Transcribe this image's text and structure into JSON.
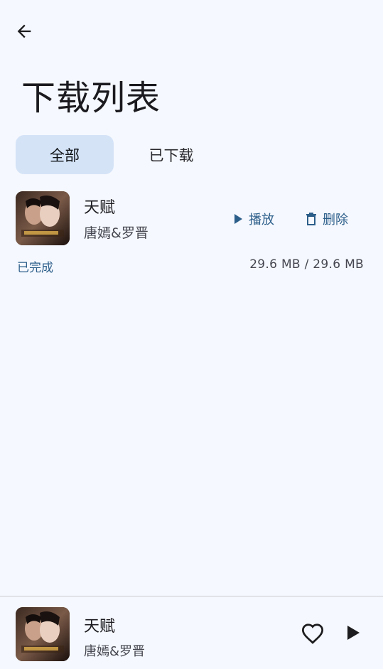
{
  "header": {
    "back_icon": "arrow-left-icon",
    "title": "下载列表"
  },
  "tabs": [
    {
      "label": "全部",
      "active": true
    },
    {
      "label": "已下载",
      "active": false
    }
  ],
  "downloads": [
    {
      "title": "天赋",
      "artist": "唐嫣&罗晋",
      "play_label": "播放",
      "delete_label": "删除",
      "status": "已完成",
      "size": "29.6 MB / 29.6 MB"
    }
  ],
  "player": {
    "title": "天赋",
    "artist": "唐嫣&罗晋",
    "like_icon": "heart-outline-icon",
    "play_icon": "play-icon"
  },
  "colors": {
    "background": "#f5f8fe",
    "active_tab": "#d5e3f7",
    "accent": "#2c5e8a"
  }
}
